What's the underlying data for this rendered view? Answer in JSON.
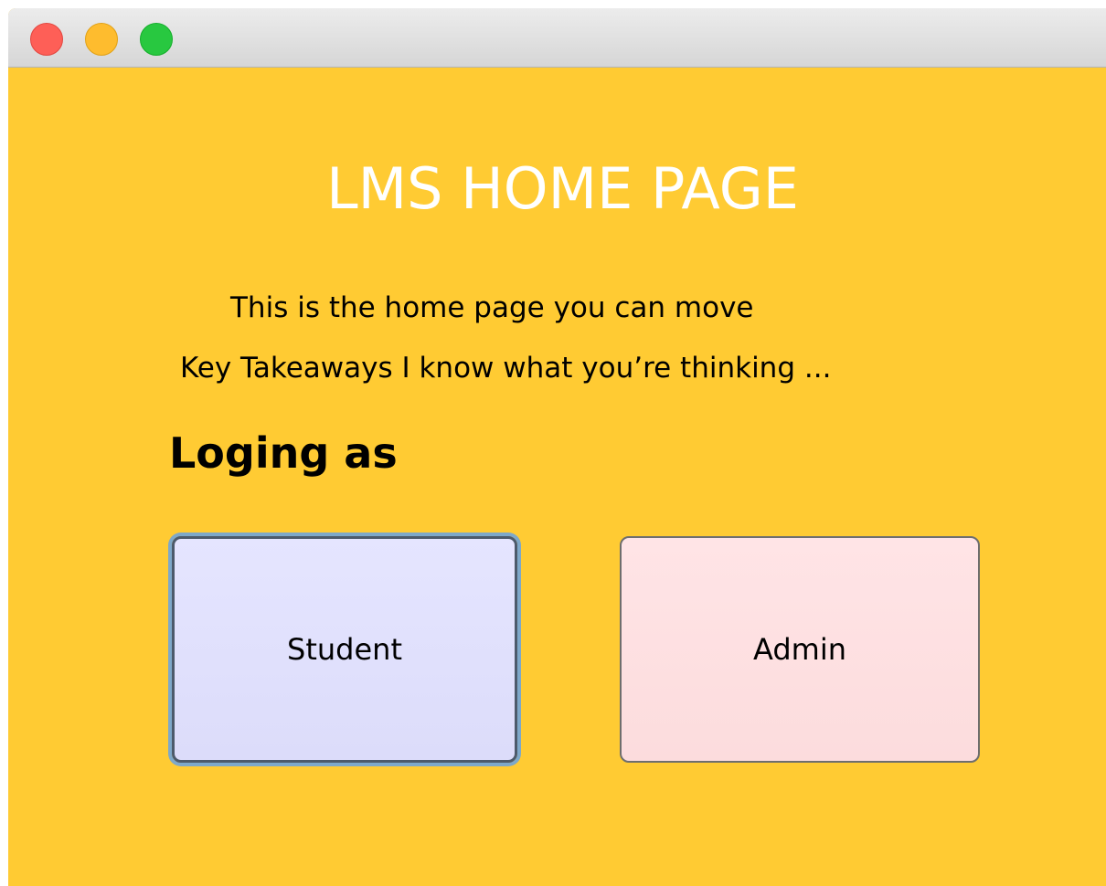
{
  "window": {
    "controls": {
      "close_color": "#fe5f57",
      "minimize_color": "#febc2e",
      "zoom_color": "#28c840"
    },
    "background_color": "#ffcb33"
  },
  "main": {
    "title": "LMS HOME PAGE",
    "description_line1": "This is the home page you can move",
    "description_line2": "Key Takeaways I know what you’re thinking ...",
    "login_heading": "Loging as",
    "buttons": {
      "student_label": "Student",
      "admin_label": "Admin"
    }
  }
}
